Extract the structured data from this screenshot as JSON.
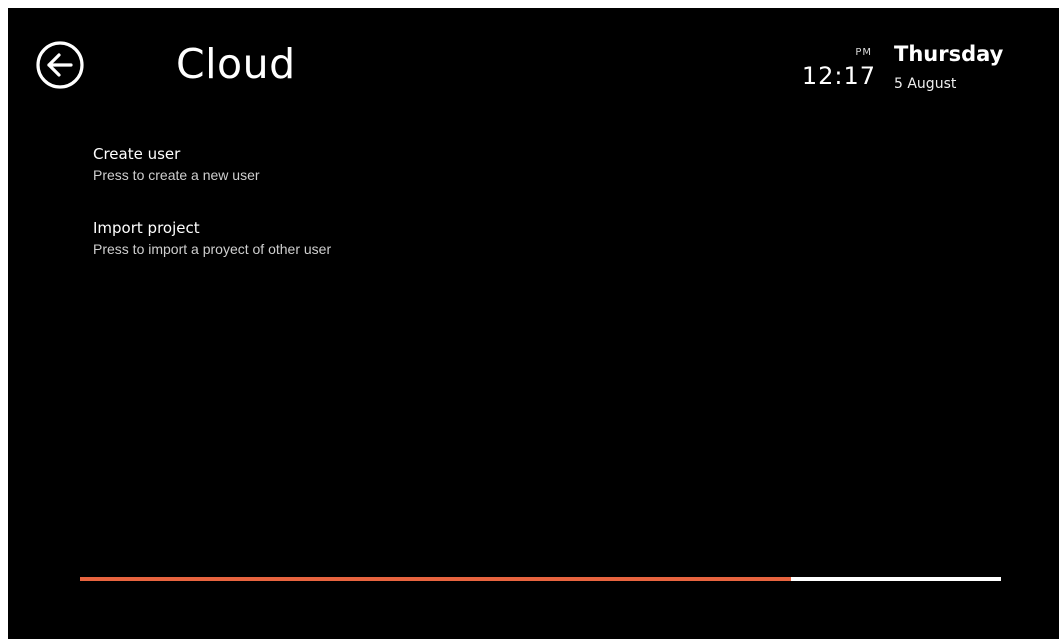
{
  "header": {
    "title": "Cloud",
    "back_icon": "arrow-left-circle-icon"
  },
  "clock": {
    "time": "12:17",
    "ampm": "PM",
    "day": "Thursday",
    "date": "5 August"
  },
  "menu": {
    "items": [
      {
        "title": "Create user",
        "description": "Press to create a new user"
      },
      {
        "title": "Import project",
        "description": "Press to import a proyect of other user"
      }
    ]
  },
  "progress": {
    "fraction": 0.772,
    "fill_color": "#e8643f",
    "track_color": "#ffffff"
  },
  "colors": {
    "background": "#000000",
    "text": "#ffffff",
    "accent": "#e8643f"
  }
}
